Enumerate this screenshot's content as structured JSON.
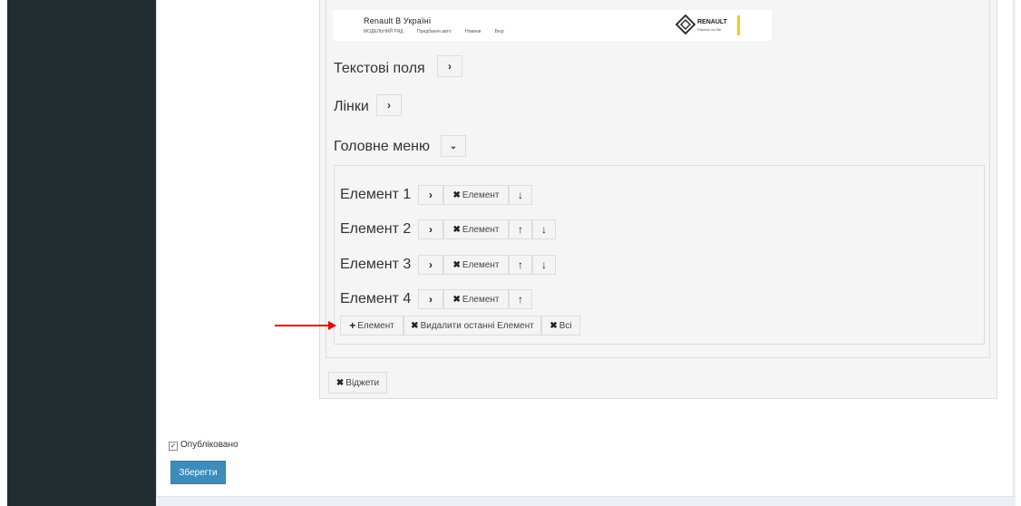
{
  "preview": {
    "brand_title": "Renault В Україні",
    "nav_items": [
      "МОДЕЛЬНИЙ РЯД",
      "Придбання авто",
      "Новини",
      "Бюр"
    ],
    "logo_text": "RENAULT",
    "logo_sub": "Passion for life"
  },
  "sections": {
    "text_fields": "Текстові поля",
    "links": "Лінки",
    "main_menu": "Головне меню"
  },
  "elements": [
    {
      "label": "Елемент 1",
      "remove_label": "Елемент"
    },
    {
      "label": "Елемент 2",
      "remove_label": "Елемент"
    },
    {
      "label": "Елемент 3",
      "remove_label": "Елемент"
    },
    {
      "label": "Елемент 4",
      "remove_label": "Елемент"
    }
  ],
  "actions": {
    "add_element": "Елемент",
    "remove_last": "Видалити останні Елемент",
    "all": "Всі",
    "widgets": "Віджети"
  },
  "form": {
    "published_label": "Опубліковано",
    "published_checked": true,
    "save_label": "Зберегти"
  },
  "colors": {
    "sidebar": "#222d32",
    "primary_button": "#3c8dbc",
    "annotation_arrow": "#e00000"
  }
}
